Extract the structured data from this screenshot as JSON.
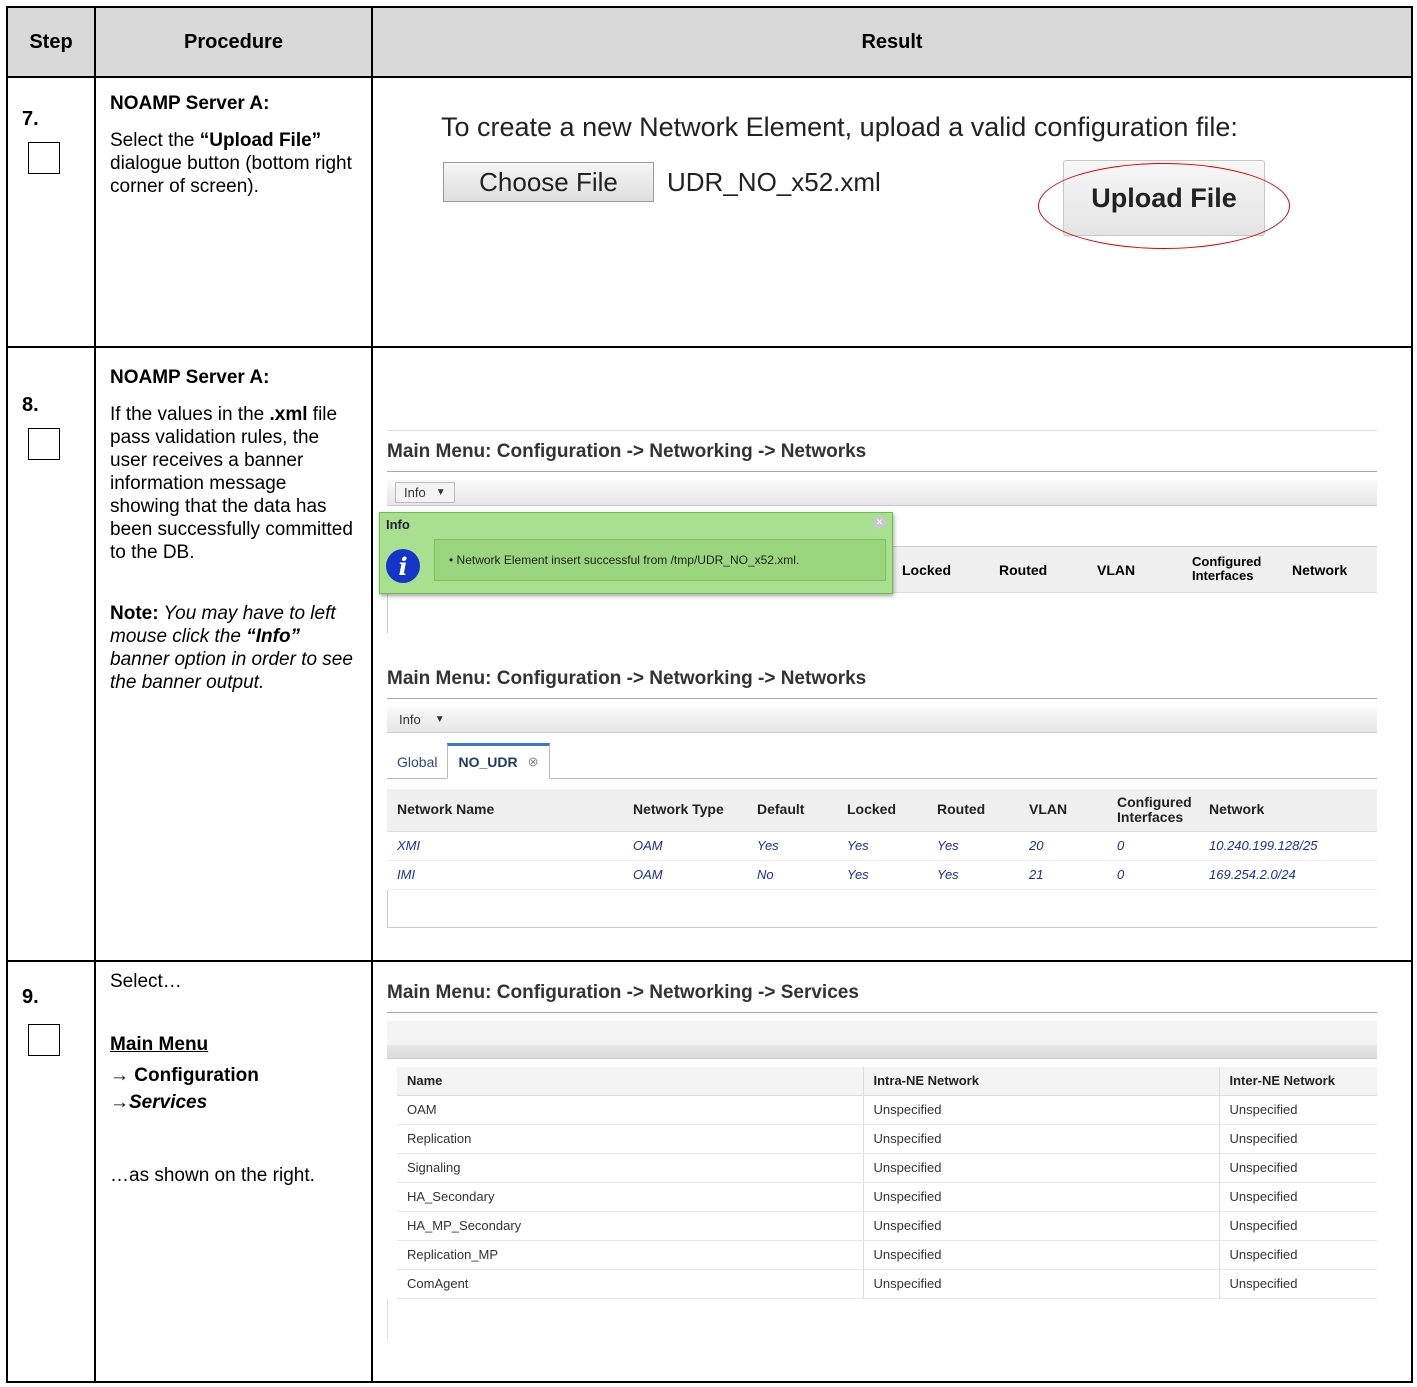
{
  "headers": {
    "step": "Step",
    "procedure": "Procedure",
    "result": "Result"
  },
  "step7": {
    "num": "7.",
    "title": "NOAMP Server A:",
    "text_pre": "Select the ",
    "text_bold": "“Upload File”",
    "text_post": " dialogue button (bottom right corner of screen).",
    "upload_title": "To create a new Network Element, upload a valid configuration file:",
    "choose_label": "Choose File",
    "file_name": "UDR_NO_x52.xml",
    "upload_label": "Upload File"
  },
  "step8": {
    "num": "8.",
    "title": "NOAMP Server A:",
    "p1_a": "If the values in the ",
    "p1_bold": ".xml",
    "p1_b": " file pass validation rules, the user receives a banner information message showing that the data has been successfully committed to the DB.",
    "note_label": "Note:",
    "note_a": " You may have to left mouse click the ",
    "note_bold": "“Info”",
    "note_b": " banner option in order to see the banner output.",
    "screen1": {
      "title": "Main Menu: Configuration -> Networking -> Networks",
      "info_label": "Info",
      "banner_title": "Info",
      "banner_message": "• Network Element insert successful from /tmp/UDR_NO_x52.xml.",
      "columns": [
        "Locked",
        "Routed",
        "VLAN",
        "Configured Interfaces",
        "Network"
      ]
    },
    "screen2": {
      "title": "Main Menu: Configuration -> Networking -> Networks",
      "info_label": "Info",
      "tab_global": "Global",
      "tab_active": "NO_UDR",
      "columns": [
        "Network Name",
        "Network Type",
        "Default",
        "Locked",
        "Routed",
        "VLAN",
        "Configured Interfaces",
        "Network"
      ],
      "rows": [
        [
          "XMI",
          "OAM",
          "Yes",
          "Yes",
          "Yes",
          "20",
          "0",
          "10.240.199.128/25"
        ],
        [
          "IMI",
          "OAM",
          "No",
          "Yes",
          "Yes",
          "21",
          "0",
          "169.254.2.0/24"
        ]
      ]
    }
  },
  "step9": {
    "num": "9.",
    "select": "Select…",
    "main_menu": "Main Menu",
    "config": "→ Configuration",
    "services": "→Services",
    "as_shown": "…as shown on the right.",
    "screen": {
      "title": "Main Menu: Configuration -> Networking -> Services",
      "columns": [
        "Name",
        "Intra-NE Network",
        "Inter-NE Network"
      ],
      "rows": [
        [
          "OAM",
          "Unspecified",
          "Unspecified"
        ],
        [
          "Replication",
          "Unspecified",
          "Unspecified"
        ],
        [
          "Signaling",
          "Unspecified",
          "Unspecified"
        ],
        [
          "HA_Secondary",
          "Unspecified",
          "Unspecified"
        ],
        [
          "HA_MP_Secondary",
          "Unspecified",
          "Unspecified"
        ],
        [
          "Replication_MP",
          "Unspecified",
          "Unspecified"
        ],
        [
          "ComAgent",
          "Unspecified",
          "Unspecified"
        ]
      ]
    }
  }
}
